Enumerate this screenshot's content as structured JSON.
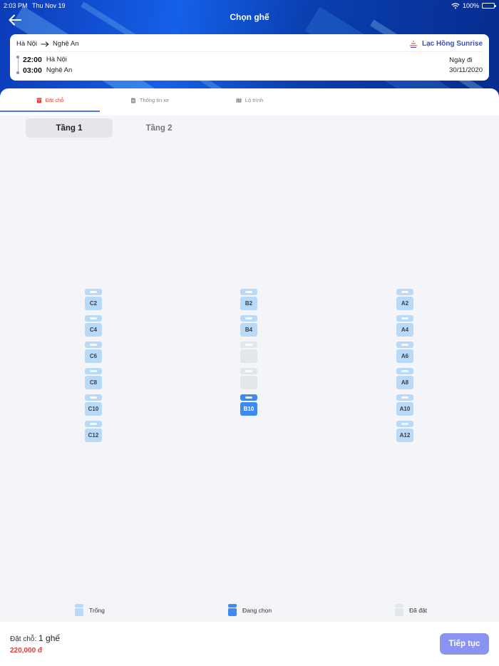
{
  "status_bar": {
    "time": "2:03 PM",
    "date": "Thu Nov 19",
    "battery": "100%"
  },
  "header": {
    "title": "Chọn ghế"
  },
  "trip": {
    "from": "Hà Nội",
    "to": "Nghệ An",
    "operator": "Lạc Hồng Sunrise",
    "departure_time": "22:00",
    "departure_place": "Hà Nội",
    "arrival_time": "03:00",
    "arrival_place": "Nghệ An",
    "date_label": "Ngày đi",
    "date": "30/11/2020"
  },
  "tabs": [
    {
      "label": "Đặt chỗ",
      "active": true
    },
    {
      "label": "Thông tin xe",
      "active": false
    },
    {
      "label": "Lộ trình",
      "active": false
    }
  ],
  "floors": [
    {
      "label": "Tầng 1",
      "active": true
    },
    {
      "label": "Tầng 2",
      "active": false
    }
  ],
  "seats": {
    "col_c": [
      {
        "label": "C2",
        "state": "empty"
      },
      {
        "label": "C4",
        "state": "empty"
      },
      {
        "label": "C6",
        "state": "empty"
      },
      {
        "label": "C8",
        "state": "empty"
      },
      {
        "label": "C10",
        "state": "empty"
      },
      {
        "label": "C12",
        "state": "empty"
      }
    ],
    "col_b": [
      {
        "label": "B2",
        "state": "empty"
      },
      {
        "label": "B4",
        "state": "empty"
      },
      {
        "label": "",
        "state": "booked"
      },
      {
        "label": "",
        "state": "booked"
      },
      {
        "label": "B10",
        "state": "selected"
      }
    ],
    "col_a": [
      {
        "label": "A2",
        "state": "empty"
      },
      {
        "label": "A4",
        "state": "empty"
      },
      {
        "label": "A6",
        "state": "empty"
      },
      {
        "label": "A8",
        "state": "empty"
      },
      {
        "label": "A10",
        "state": "empty"
      },
      {
        "label": "A12",
        "state": "empty"
      }
    ]
  },
  "legend": {
    "empty": "Trống",
    "selected": "Đang chọn",
    "booked": "Đã đặt"
  },
  "footer": {
    "booked_label": "Đặt chỗ:",
    "booked_count": "1 ghế",
    "price": "220,000 đ",
    "continue_label": "Tiếp tục"
  },
  "colors": {
    "accent": "#3d8bf0",
    "seat_empty": "#b8d9f7",
    "seat_booked": "#e3e6eb",
    "price": "#e23c3c",
    "button": "#8a93f0"
  }
}
